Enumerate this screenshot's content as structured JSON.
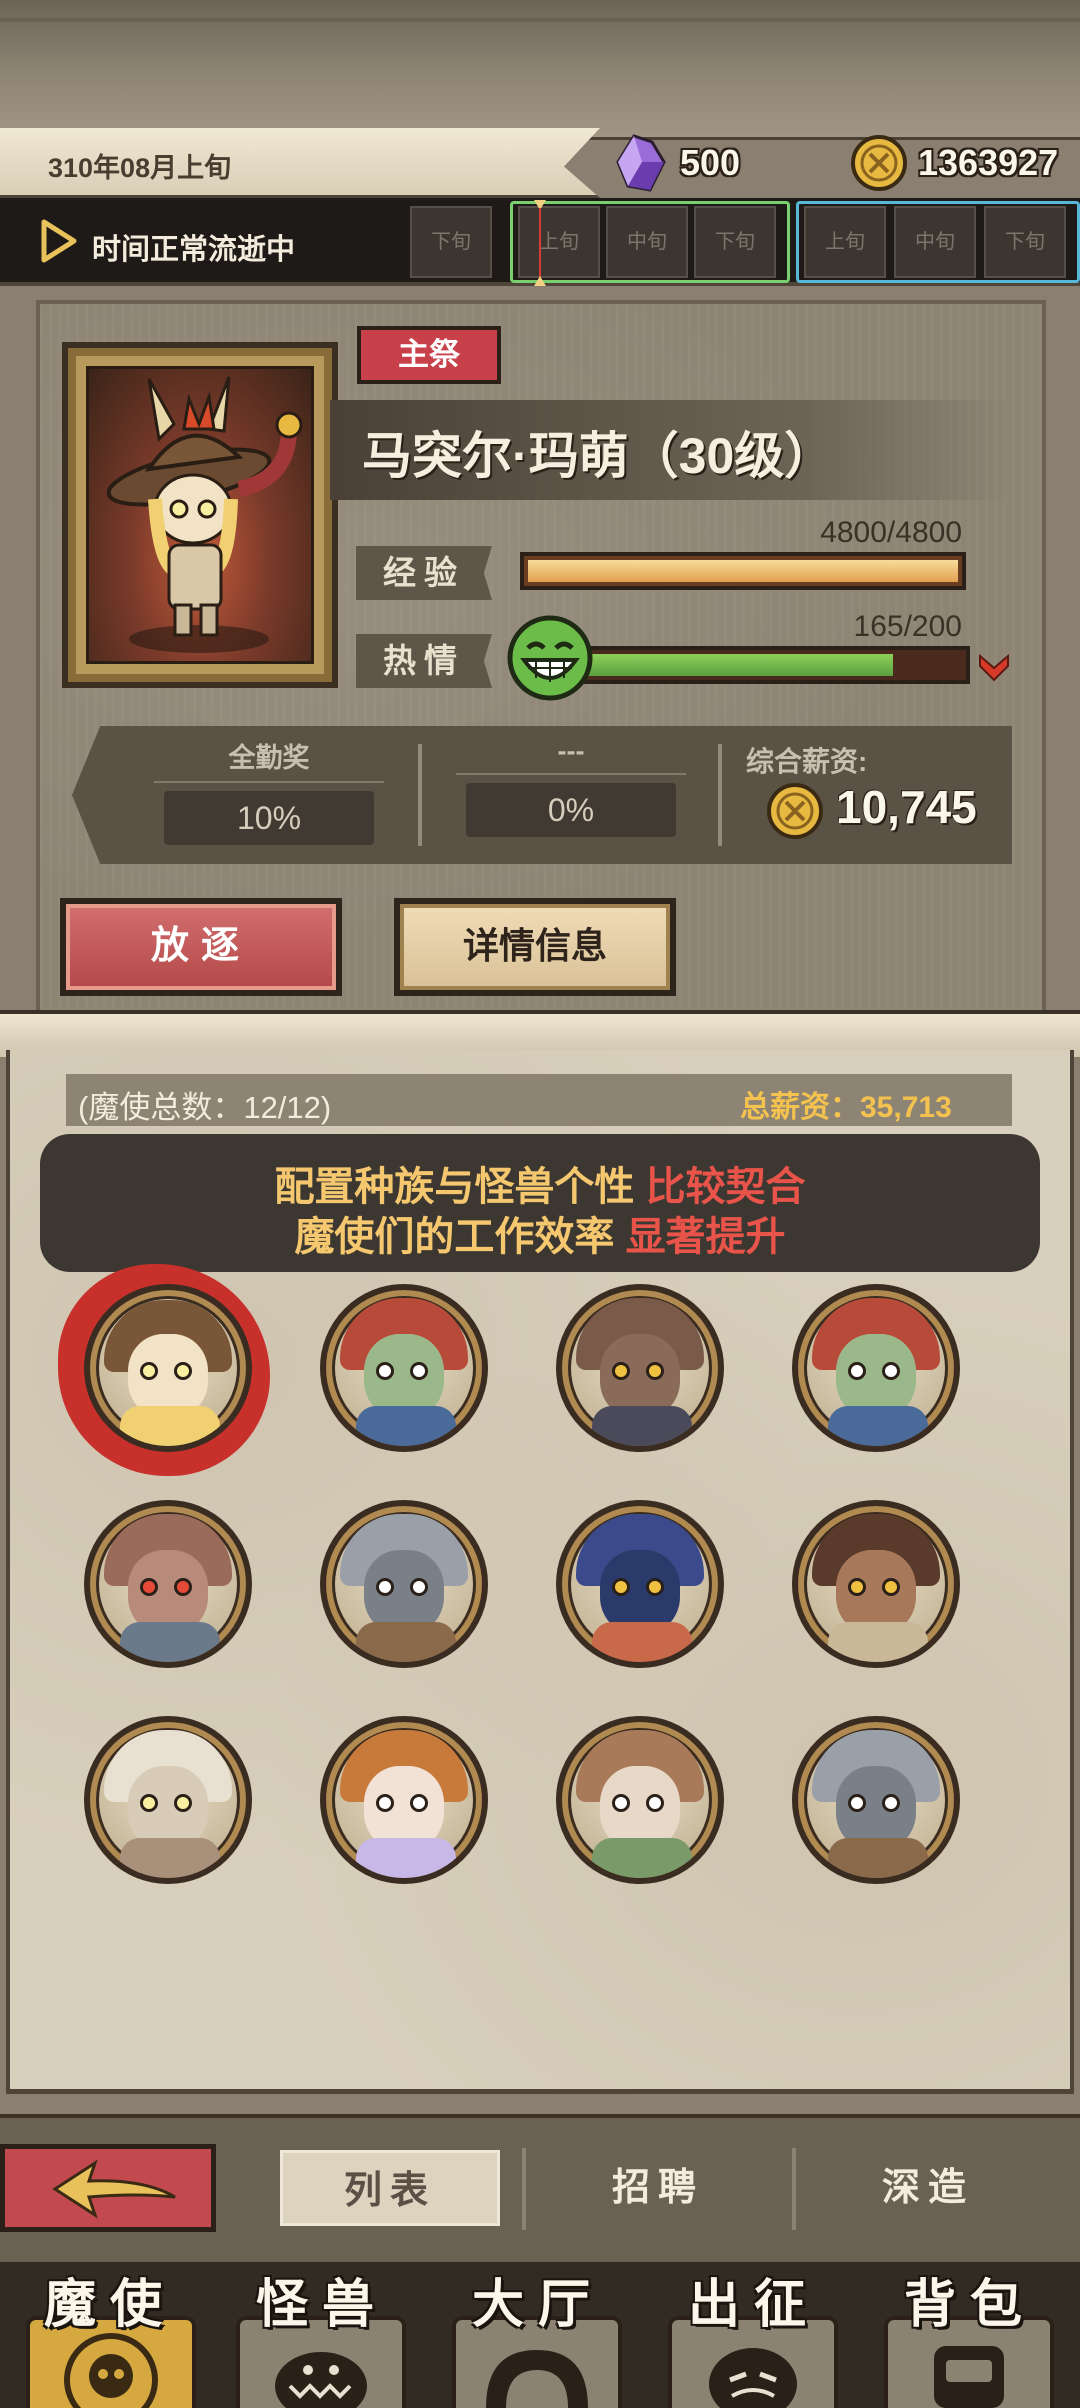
{
  "header": {
    "date": "310年08月上旬",
    "crystal": "500",
    "gold": "1363927"
  },
  "time": {
    "status": "时间正常流逝中",
    "slots": [
      "下旬",
      "上旬",
      "中旬",
      "下旬",
      "上旬",
      "中旬",
      "下旬"
    ]
  },
  "character": {
    "role_badge": "主祭",
    "name": "马突尔·玛萌（30级）",
    "exp_label": "经验",
    "exp_value": "4800/4800",
    "exp_fraction": 1.0,
    "passion_label": "热情",
    "passion_value": "165/200",
    "passion_fraction": 0.825
  },
  "salary": {
    "bonus1_title": "全勤奖",
    "bonus1_value": "10%",
    "bonus2_title": "---",
    "bonus2_value": "0%",
    "total_title": "综合薪资:",
    "total_value": "10,745"
  },
  "actions": {
    "exile": "放逐",
    "detail": "详情信息"
  },
  "roster": {
    "count": "(魔使总数：12/12)",
    "total_pay": "总薪资：35,713",
    "tip_line1_a": "配置种族与怪兽个性",
    "tip_line1_b": "比较契合",
    "tip_line2_a": "魔使们的工作效率",
    "tip_line2_b": "显著提升"
  },
  "sub_tabs": [
    "列表",
    "招聘",
    "深造"
  ],
  "main_tabs": [
    "魔使",
    "怪兽",
    "大厅",
    "出征",
    "背包"
  ],
  "colors": {
    "accent_red": "#c8414a",
    "gold_text": "#f4c24e",
    "exp_fill": "#e2a050",
    "passion_fill": "#5aa040"
  },
  "icons": {
    "gem": "purple-crystal-icon",
    "coin": "gold-coin-icon",
    "play": "play-icon",
    "passion": "smile-icon",
    "trend": "down-arrow-icon",
    "back": "back-arrow-icon"
  }
}
